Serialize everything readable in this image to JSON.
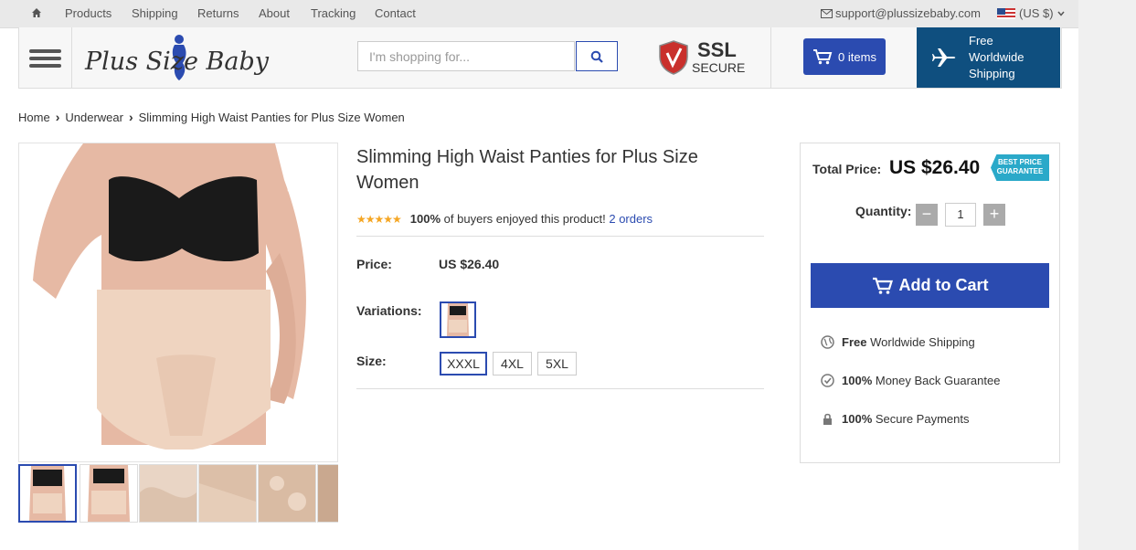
{
  "topnav": {
    "home_icon": "home-icon",
    "links": [
      "Products",
      "Shipping",
      "Returns",
      "About",
      "Tracking",
      "Contact"
    ],
    "email": "support@plussizebaby.com",
    "currency": "(US $)"
  },
  "header": {
    "logo_text": "Plus Size Baby",
    "search_placeholder": "I'm shopping for...",
    "ssl_title": "SSL",
    "ssl_sub": "SECURE",
    "cart_label": "0 items",
    "shipping_lines": [
      "Free",
      "Worldwide",
      "Shipping"
    ]
  },
  "breadcrumb": [
    "Home",
    "Underwear",
    "Slimming High Waist Panties for Plus Size Women"
  ],
  "product": {
    "title": "Slimming High Waist Panties for Plus Size Women",
    "rating_percent": "100%",
    "rating_text": "of buyers enjoyed this product!",
    "orders_link": "2 orders",
    "price_label": "Price:",
    "price": "US $26.40",
    "variations_label": "Variations:",
    "size_label": "Size:",
    "sizes": [
      "XXXL",
      "4XL",
      "5XL"
    ],
    "selected_size": "XXXL"
  },
  "buybox": {
    "total_label": "Total Price:",
    "total_value": "US $26.40",
    "badge": "BEST PRICE GUARANTEE",
    "quantity_label": "Quantity:",
    "quantity": "1",
    "add_to_cart": "Add to Cart",
    "perks": [
      {
        "bold": "Free",
        "text": "Worldwide Shipping",
        "icon": "globe-icon"
      },
      {
        "bold": "100%",
        "text": "Money Back Guarantee",
        "icon": "check-circle-icon"
      },
      {
        "bold": "100%",
        "text": "Secure Payments",
        "icon": "lock-icon"
      }
    ]
  },
  "colors": {
    "accent": "#2b4bb0",
    "ship_box": "#0f4f7f",
    "badge": "#2aa9c9",
    "stars": "#f5a623"
  }
}
